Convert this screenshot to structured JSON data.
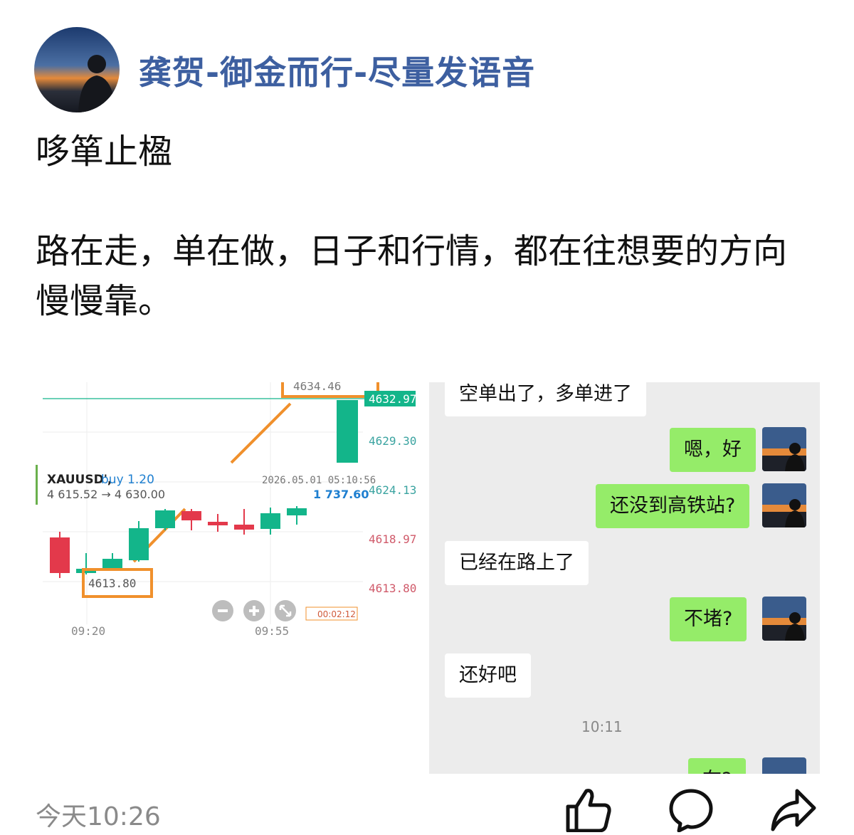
{
  "post": {
    "author": "龚贺-御金而行-尽量发语音",
    "title": "哆箪止楹",
    "body": "路在走，单在做，日子和行情，都在往想要的方向慢慢靠。",
    "time": "今天10:26"
  },
  "chart": {
    "symbol": "XAUUSD',",
    "side": "buy 1.20",
    "datetime": "2026.05.01 05:10:56",
    "price_change": "4 615.52 → 4 630.00",
    "profit": "1 737.60",
    "price_labels": [
      "4629.30",
      "4624.13",
      "4618.97",
      "4613.80"
    ],
    "current_price": "4632.97",
    "top_partial": "4634.46",
    "low_mark": "4613.80",
    "time_labels": [
      "09:20",
      "09:55"
    ],
    "timer": "00:02:12",
    "colors": {
      "up": "#13b58a",
      "down": "#e3394b",
      "highlight": "#f0902c",
      "profit": "#1e7fd0"
    }
  },
  "chat": {
    "messages": [
      {
        "from": "them",
        "text": "空单出了，多单进了"
      },
      {
        "from": "me",
        "text": "嗯，好"
      },
      {
        "from": "me",
        "text": "还没到高铁站?"
      },
      {
        "from": "them",
        "text": "已经在路上了"
      },
      {
        "from": "me",
        "text": "不堵?"
      },
      {
        "from": "them",
        "text": "还好吧"
      },
      {
        "from": "me",
        "text": "在?"
      }
    ],
    "timestamp": "10:11"
  },
  "actions": {
    "icons": [
      "thumbs-up-icon",
      "comment-icon",
      "share-icon"
    ]
  }
}
